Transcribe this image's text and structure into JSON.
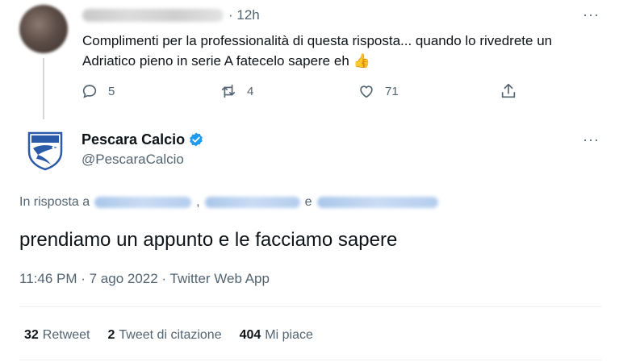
{
  "reply_tweet": {
    "time": "· 12h",
    "text": "Complimenti per la professionalità di questa risposta... quando lo rivedrete un Adriatico pieno in serie A fatecelo sapere eh",
    "emoji": "👍",
    "replies": "5",
    "retweets": "4",
    "likes": "71",
    "more_label": "···"
  },
  "main_tweet": {
    "name": "Pescara Calcio",
    "handle": "@PescaraCalcio",
    "more_label": "···",
    "in_reply_prefix": "In risposta a",
    "in_reply_sep": ",",
    "in_reply_and": "e",
    "text": "prendiamo un appunto e le facciamo sapere",
    "meta": "11:46 PM · 7 ago 2022 · Twitter Web App",
    "stats": {
      "retweets_count": "32",
      "retweets_label": "Retweet",
      "quotes_count": "2",
      "quotes_label": "Tweet di citazione",
      "likes_count": "404",
      "likes_label": "Mi piace"
    }
  },
  "colors": {
    "text": "#0f1419",
    "secondary": "#536471",
    "verified": "#1d9bf0",
    "logo_blue": "#2a5aa8"
  },
  "icons": [
    "reply-icon",
    "retweet-icon",
    "like-icon",
    "share-icon",
    "verified-badge-icon",
    "more-icon"
  ]
}
